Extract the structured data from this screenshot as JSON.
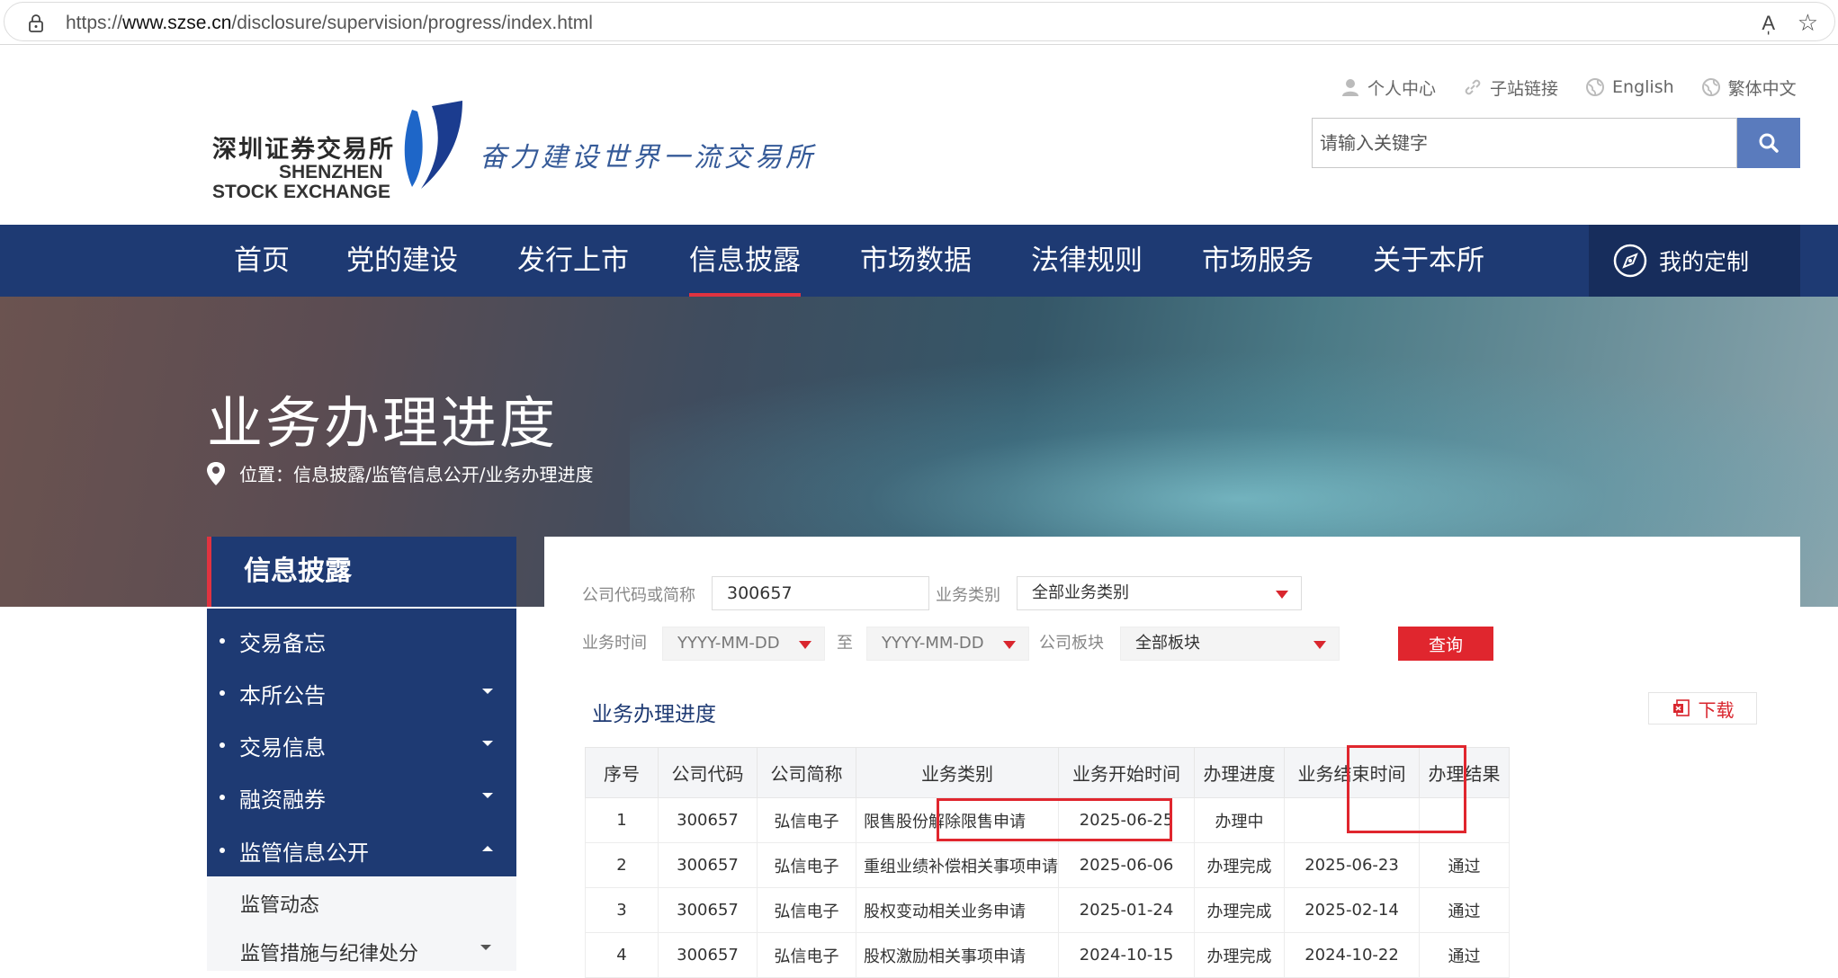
{
  "browser": {
    "url_prefix": "https://",
    "url_domain": "www.szse.cn",
    "url_path": "/disclosure/supervision/progress/index.html",
    "read_aloud": "A̩",
    "favorite": "☆"
  },
  "header": {
    "logo_cn": "深圳证券交易所",
    "logo_en_line1": "SHENZHEN",
    "logo_en_line2": "STOCK EXCHANGE",
    "slogan": "奋力建设世界一流交易所",
    "top_links": [
      "个人中心",
      "子站链接",
      "English",
      "繁体中文"
    ],
    "search_placeholder": "请输入关键字"
  },
  "nav": {
    "items": [
      "首页",
      "党的建设",
      "发行上市",
      "信息披露",
      "市场数据",
      "法律规则",
      "市场服务",
      "关于本所"
    ],
    "active": "信息披露",
    "custom": "我的定制"
  },
  "banner": {
    "title": "业务办理进度",
    "breadcrumb": "位置：信息披露/监管信息公开/业务办理进度"
  },
  "sidebar": {
    "title": "信息披露",
    "items": [
      "交易备忘",
      "本所公告",
      "交易信息",
      "融资融券",
      "监管信息公开"
    ],
    "sub_items": [
      "监管动态",
      "监管措施与纪律处分"
    ]
  },
  "filters": {
    "company_label": "公司代码或简称",
    "company_value": "300657",
    "biz_type_label": "业务类别",
    "biz_type_value": "全部业务类别",
    "biz_time_label": "业务时间",
    "date_from": "YYYY-MM-DD",
    "to_label": "至",
    "date_to": "YYYY-MM-DD",
    "board_label": "公司板块",
    "board_value": "全部板块",
    "query_label": "查询"
  },
  "table": {
    "title": "业务办理进度",
    "download_label": "下载",
    "columns": [
      "序号",
      "公司代码",
      "公司简称",
      "业务类别",
      "业务开始时间",
      "办理进度",
      "业务结束时间",
      "办理结果"
    ],
    "rows": [
      [
        "1",
        "300657",
        "弘信电子",
        "限售股份解除限售申请",
        "2025-06-25",
        "办理中",
        "",
        ""
      ],
      [
        "2",
        "300657",
        "弘信电子",
        "重组业绩补偿相关事项申请",
        "2025-06-06",
        "办理完成",
        "2025-06-23",
        "通过"
      ],
      [
        "3",
        "300657",
        "弘信电子",
        "股权变动相关业务申请",
        "2025-01-24",
        "办理完成",
        "2025-02-14",
        "通过"
      ],
      [
        "4",
        "300657",
        "弘信电子",
        "股权激励相关事项申请",
        "2024-10-15",
        "办理完成",
        "2024-10-22",
        "通过"
      ]
    ]
  },
  "colors": {
    "nav_blue": "#1e3a73",
    "accent_red": "#e0262e",
    "search_blue": "#5a7bbd"
  }
}
